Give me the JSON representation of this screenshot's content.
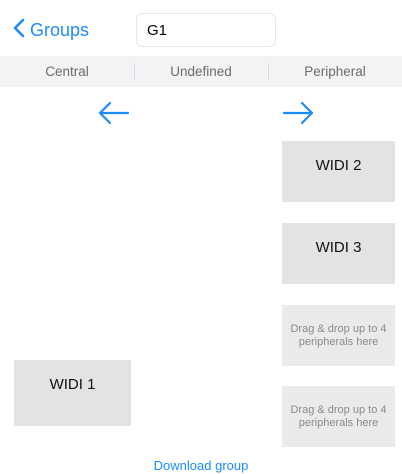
{
  "nav": {
    "back_label": "Groups",
    "group_name_value": "G1"
  },
  "tabs": [
    "Central",
    "Undefined",
    "Peripheral"
  ],
  "central": {
    "devices": [
      "WIDI 1"
    ]
  },
  "peripheral": {
    "devices": [
      "WIDI 2",
      "WIDI 3"
    ],
    "drop_zones": [
      "Drag & drop up to 4 peripherals here",
      "Drag & drop up to 4 peripherals here"
    ]
  },
  "actions": {
    "download_label": "Download group"
  },
  "icons": {
    "back": "chevron-left-icon",
    "move_left": "arrow-left-icon",
    "move_right": "arrow-right-icon"
  },
  "colors": {
    "accent": "#1a8cff",
    "tile": "#e3e3e3",
    "segbar": "#f3f3f5"
  }
}
